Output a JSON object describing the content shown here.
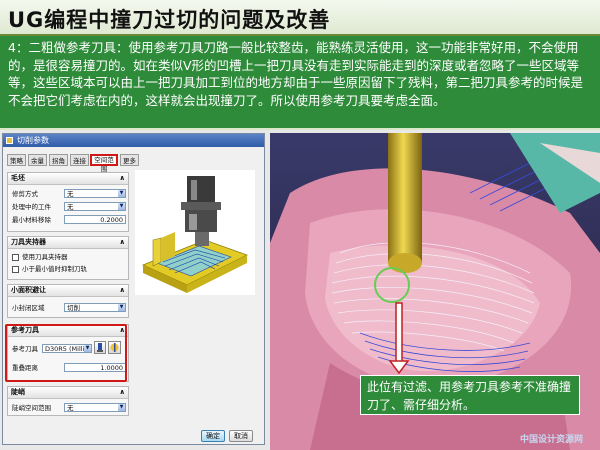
{
  "slide": {
    "title": "UG编程中撞刀过切的问题及改善",
    "intro": "4：二粗做参考刀具：使用参考刀具刀路一般比较整齿，能熟练灵活使用，这一功能非常好用，不会使用的，是很容易撞刀的。如在类似V形的凹槽上一把刀具没有走到实际能走到的深度或者忽略了一些区域等等，这些区域本可以由上一把刀具加工到位的地方却由于一些原因留下了残料，第二把刀具参考的时候是不会把它们考虑在内的，这样就会出现撞刀了。所以使用参考刀具要考虑全面。",
    "callout": "此位有过滤、用参考刀具参考不准确撞刀了、需仔细分析。",
    "watermark": "中国设计资源网"
  },
  "dialog": {
    "title": "切削参数",
    "tabs": [
      "策略",
      "余量",
      "拐角",
      "连接",
      "空间范围",
      "更多"
    ],
    "active_tab": "空间范围",
    "blank": {
      "header": "毛坯",
      "trim_label": "修剪方式",
      "trim_value": "无",
      "wip_label": "处理中的工件",
      "wip_value": "无",
      "min_remove_label": "最小材料移除",
      "min_remove_value": "0.2000"
    },
    "holder": {
      "header": "刀具夹持器",
      "use_holder": "使用刀具夹持器",
      "smaller_than_min": "小于最小值时抑制刀轨"
    },
    "small_area": {
      "header": "小面积避让",
      "label": "小封闭区域",
      "value": "切削"
    },
    "ref_tool": {
      "header": "参考刀具",
      "label": "参考刀具",
      "value": "D30R5 (Millin",
      "overlap_label": "重叠距离",
      "overlap_value": "1.0000"
    },
    "steep": {
      "header": "陡峭",
      "label": "陡峭空间范围",
      "value": "无"
    },
    "ok": "确定",
    "cancel": "取消"
  },
  "colors": {
    "slide_green": "#2e8b3a",
    "highlight_red": "#d01818",
    "dialog_title_blue": "#2f5ba8",
    "pink_surface": "#e8a0b8",
    "tool_yellow": "#d8b830"
  }
}
